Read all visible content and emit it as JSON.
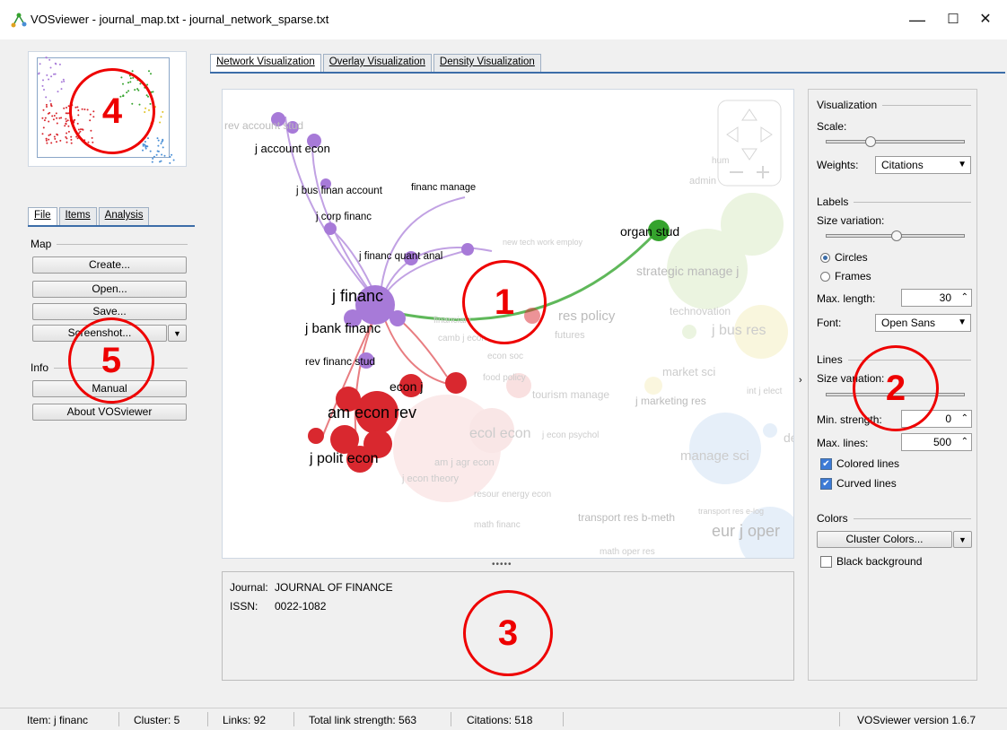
{
  "window": {
    "title": "VOSviewer - journal_map.txt - journal_network_sparse.txt",
    "minimize": "—",
    "maximize": "☐",
    "close": "✕"
  },
  "left_tabs": [
    {
      "label": "File",
      "active": true
    },
    {
      "label": "Items",
      "active": false
    },
    {
      "label": "Analysis",
      "active": false
    }
  ],
  "file_panel": {
    "map_section": "Map",
    "create": "Create...",
    "open": "Open...",
    "save": "Save...",
    "screenshot": "Screenshot...",
    "info_section": "Info",
    "manual": "Manual",
    "about": "About VOSviewer"
  },
  "main_tabs": [
    {
      "label": "Network Visualization",
      "active": true
    },
    {
      "label": "Overlay Visualization",
      "active": false
    },
    {
      "label": "Density Visualization",
      "active": false
    }
  ],
  "map_labels": {
    "rev_account_stud": "rev account stud",
    "j_account_econ": "j account econ",
    "j_bus_finan_account": "j bus finan account",
    "financ_manage": "financ manage",
    "j_corp_financ": "j corp financ",
    "j_financ_quant_anal": "j financ quant anal",
    "j_financ": "j financ",
    "j_bank_financ": "j bank financ",
    "rev_financ_stud": "rev financ stud",
    "econ_j": "econ j",
    "am_econ_rev": "am econ rev",
    "j_polit_econ": "j polit econ",
    "organ_stud": "organ stud",
    "strategic_manage_j": "strategic manage j",
    "new_tech_work_employ": "new tech work employ",
    "res_policy": "res policy",
    "technovation": "technovation",
    "j_bus_res": "j bus res",
    "futures": "futures",
    "camb_j_econ": "camb j econ",
    "financial_j": "financial j",
    "econ_soc": "econ soc",
    "food_policy": "food policy",
    "tourism_manage": "tourism manage",
    "j_marketing_res": "j marketing res",
    "market_sci": "market sci",
    "int_j_elect": "int j elect",
    "ecol_econ": "ecol econ",
    "j_econ_psychol": "j econ psychol",
    "am_j_agr_econ": "am j agr econ",
    "j_econ_theory": "j econ theory",
    "resour_energy_econ": "resour energy econ",
    "manage_sci": "manage sci",
    "de": "de",
    "math_financ": "math financ",
    "transport_res": "transport res b-meth",
    "transport_res_e": "transport res e-log",
    "eur_j_oper": "eur j oper",
    "math_oper_res": "math oper res",
    "admin": "admin",
    "hum": "hum"
  },
  "info_panel": {
    "journal_label": "Journal:",
    "journal_value": "JOURNAL OF FINANCE",
    "issn_label": "ISSN:",
    "issn_value": "0022-1082"
  },
  "right_panel": {
    "visualization": "Visualization",
    "scale": "Scale:",
    "scale_value": 0.3,
    "weights_label": "Weights:",
    "weights_value": "Citations",
    "labels": "Labels",
    "size_variation": "Size variation:",
    "label_size_value": 0.5,
    "circles": "Circles",
    "frames": "Frames",
    "max_length_label": "Max. length:",
    "max_length_value": "30",
    "font_label": "Font:",
    "font_value": "Open Sans",
    "lines": "Lines",
    "lines_size_variation": "Size variation:",
    "min_strength_label": "Min. strength:",
    "min_strength_value": "0",
    "max_lines_label": "Max. lines:",
    "max_lines_value": "500",
    "colored_lines": "Colored lines",
    "curved_lines": "Curved lines",
    "colors": "Colors",
    "cluster_colors": "Cluster Colors...",
    "black_background": "Black background"
  },
  "status_bar": {
    "item": "Item:  j financ",
    "cluster": "Cluster:  5",
    "links": "Links:  92",
    "total_link_strength": "Total link strength:  563",
    "citations": "Citations:  518",
    "version": "VOSviewer version 1.6.7"
  },
  "annotations": [
    "1",
    "2",
    "3",
    "4",
    "5"
  ],
  "colors": {
    "accent": "#3c6da8",
    "purple": "#a77ad8",
    "red": "#d9282f",
    "green": "#35a32d",
    "annotation_red": "#e00000"
  }
}
